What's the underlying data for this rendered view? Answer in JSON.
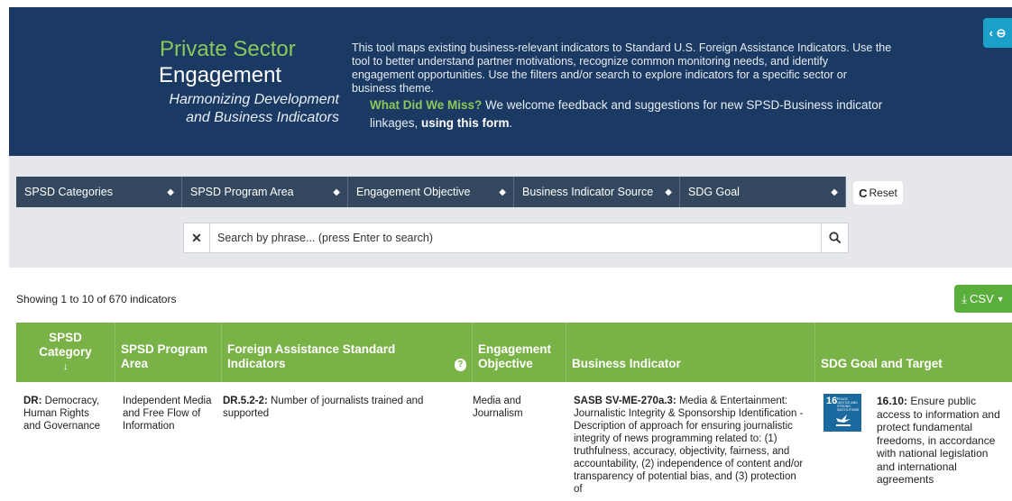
{
  "header": {
    "title_line1": "Private Sector",
    "title_line2": "Engagement",
    "subtitle": "Harmonizing Development and Business Indicators",
    "intro": "This tool maps existing business-relevant indicators to Standard U.S. Foreign Assistance Indicators. Use the tool to better understand partner motivations, recognize common monitoring needs, and identify engagement opportunities. Use the filters and/or search to explore indicators for a specific sector or business theme.",
    "feedback_lead": "What Did We Miss?",
    "feedback_text": " We welcome feedback and suggestions for new SPSD-Business indicator linkages, ",
    "feedback_link": "using this form",
    "feedback_end": ".",
    "toggle_glyph": "‹ ⊖"
  },
  "filters": [
    {
      "label": "SPSD Categories"
    },
    {
      "label": "SPSD Program Area"
    },
    {
      "label": "Engagement Objective"
    },
    {
      "label": "Business Indicator Source"
    },
    {
      "label": "SDG Goal"
    }
  ],
  "reset_label": "Reset",
  "search": {
    "placeholder": "Search by phrase... (press Enter to search)"
  },
  "count_text": "Showing 1 to 10 of 670 indicators",
  "csv_label": "CSV",
  "table": {
    "headers": [
      "SPSD Category",
      "SPSD Program Area",
      "Foreign Assistance Standard Indicators",
      "Engagement Objective",
      "Business Indicator",
      "SDG Goal and Target"
    ],
    "sort_indicator": "↓",
    "rows": [
      {
        "category_code": "DR:",
        "category_text": " Democracy, Human Rights and Governance",
        "program_area": "Independent Media and Free Flow of Information",
        "fa_code": "DR.5.2-2:",
        "fa_text": " Number of journalists trained and supported",
        "objective": "Media and Journalism",
        "bi_code": "SASB SV-ME-270a.3:",
        "bi_text": " Media & Entertainment: Journalistic Integrity & Sponsorship Identification - Description of approach for ensuring journalistic integrity of news programming related to: (1) truthfulness, accuracy, objectivity, fairness, and accountability, (2) independence of content and/or transparency of potential bias, and (3) protection of",
        "sdg_badge_number": "16",
        "sdg_badge_text": "PEACE, JUSTICE AND STRONG INSTITUTIONS",
        "sdg_code": "16.10:",
        "sdg_text": " Ensure public access to information and protect fundamental freedoms, in accordance with national legislation and international agreements"
      }
    ]
  },
  "colors": {
    "header_bg": "#1b3a63",
    "accent_green": "#8dc65a",
    "table_header_green": "#79b246",
    "filter_bg": "#33475e",
    "csv_green": "#5aaf3c",
    "toggle_blue": "#1ba0c9",
    "sdg16_blue": "#1a6aa0"
  }
}
